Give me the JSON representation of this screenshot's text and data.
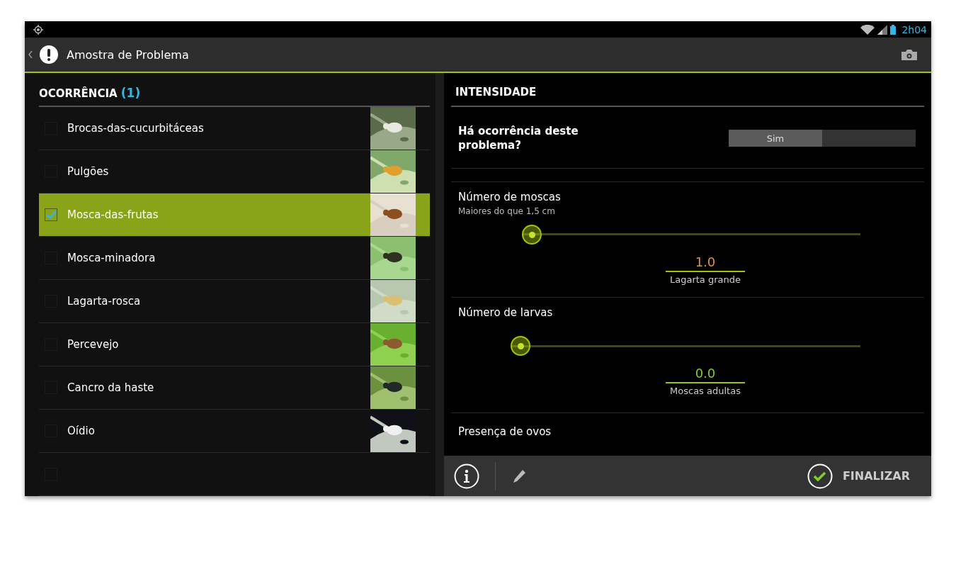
{
  "status_bar": {
    "time": "2h04"
  },
  "action_bar": {
    "title": "Amostra de Problema"
  },
  "occurrence": {
    "title": "OCORRÊNCIA",
    "count": "(1)",
    "items": [
      {
        "label": "Brocas-das-cucurbitáceas",
        "checked": false,
        "selected": false,
        "kind": "picture"
      },
      {
        "label": "Pulgões",
        "checked": false,
        "selected": false,
        "kind": "picture"
      },
      {
        "label": "Mosca-das-frutas",
        "checked": true,
        "selected": true,
        "kind": "picture"
      },
      {
        "label": "Mosca-minadora",
        "checked": false,
        "selected": false,
        "kind": "picture"
      },
      {
        "label": "Lagarta-rosca",
        "checked": false,
        "selected": false,
        "kind": "picture"
      },
      {
        "label": "Percevejo",
        "checked": false,
        "selected": false,
        "kind": "picture"
      },
      {
        "label": "Cancro da haste",
        "checked": false,
        "selected": false,
        "kind": "picture"
      },
      {
        "label": "Oídio",
        "checked": false,
        "selected": false,
        "kind": "picture"
      },
      {
        "checked": false,
        "selected": false
      }
    ]
  },
  "intensity": {
    "title": "INTENSIDADE",
    "question": {
      "label": "Há ocorrência deste problema?",
      "options": [
        {
          "label": "Sim",
          "selected": true
        }
      ]
    },
    "sliders": [
      {
        "label": "Número de moscas",
        "hint": "Maiores do que 1,5 cm",
        "value": "1.0",
        "color": "#e8913a",
        "caption": "Lagarta grande"
      },
      {
        "label": "Número de larvas",
        "value": "0.0",
        "color": "#7ed321",
        "caption": "Moscas adultas"
      }
    ],
    "next_item": "Presença de ovos"
  },
  "bottom_bar": {
    "finish": "FINALIZAR"
  }
}
